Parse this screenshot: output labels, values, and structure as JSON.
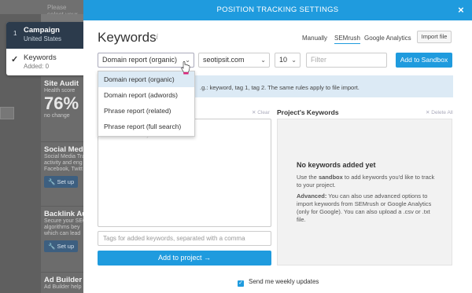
{
  "background": {
    "top_text": "Please select your",
    "cards": [
      {
        "title": "Site Audit",
        "lines": [
          "Health score"
        ],
        "big": "76",
        "after": "no change"
      },
      {
        "title": "Social Media",
        "lines": [
          "Social Media Tra",
          "activity and eng",
          "Facebook, Twitt"
        ],
        "button": "Set up"
      },
      {
        "title": "Backlink Audit",
        "lines": [
          "Secure your SEO",
          "algorithms bey",
          "which can lead"
        ],
        "button": "Set up"
      },
      {
        "title": "Ad Builder",
        "lines": [
          "Ad Builder help"
        ]
      }
    ]
  },
  "steps": [
    {
      "num": "1",
      "title": "Campaign",
      "subtitle": "United States"
    },
    {
      "check": "✓",
      "title": "Keywords",
      "subtitle": "Added: 0"
    }
  ],
  "modal": {
    "header": "POSITION TRACKING SETTINGS",
    "close": "×",
    "title": "Keywords",
    "title_info": "i",
    "source_tabs": [
      "Manually",
      "SEMrush",
      "Google Analytics"
    ],
    "import_label": "Import file",
    "report_select": "Domain report (organic)",
    "domain_select": "seotipsit.com",
    "count_select": "10",
    "filter_placeholder": "Filter",
    "sandbox_label": "Add to Sandbox",
    "info_text": ".g.: keyword, tag 1, tag 2. The same rules apply to file import.",
    "left_clear": "✕ Clear",
    "textarea_placeholder": "Paste or enter keywords",
    "tags_placeholder": "Tags for added keywords, separated with a comma",
    "add_label": "Add to project →",
    "project_heading": "Project's Keywords",
    "project_delete": "✕ Delete All",
    "empty_title": "No keywords added yet",
    "empty_p1_a": "Use the ",
    "empty_p1_b": "sandbox",
    "empty_p1_c": " to add keywords you'd like to track to your project.",
    "empty_p2_a": "Advanced:",
    "empty_p2_b": " You can also use advanced options to import keywords from SEMrush or Google Analytics (only for Google). You can also upload a .csv or .txt file.",
    "weekly_label": "Send me weekly updates",
    "dropdown_options": [
      "Domain report (organic)",
      "Domain report (adwords)",
      "Phrase report (related)",
      "Phrase report (full search)"
    ]
  },
  "colors": {
    "accent": "#1f9bde",
    "step_dark": "#2c3b4c",
    "info_bg": "#dceaf5"
  }
}
